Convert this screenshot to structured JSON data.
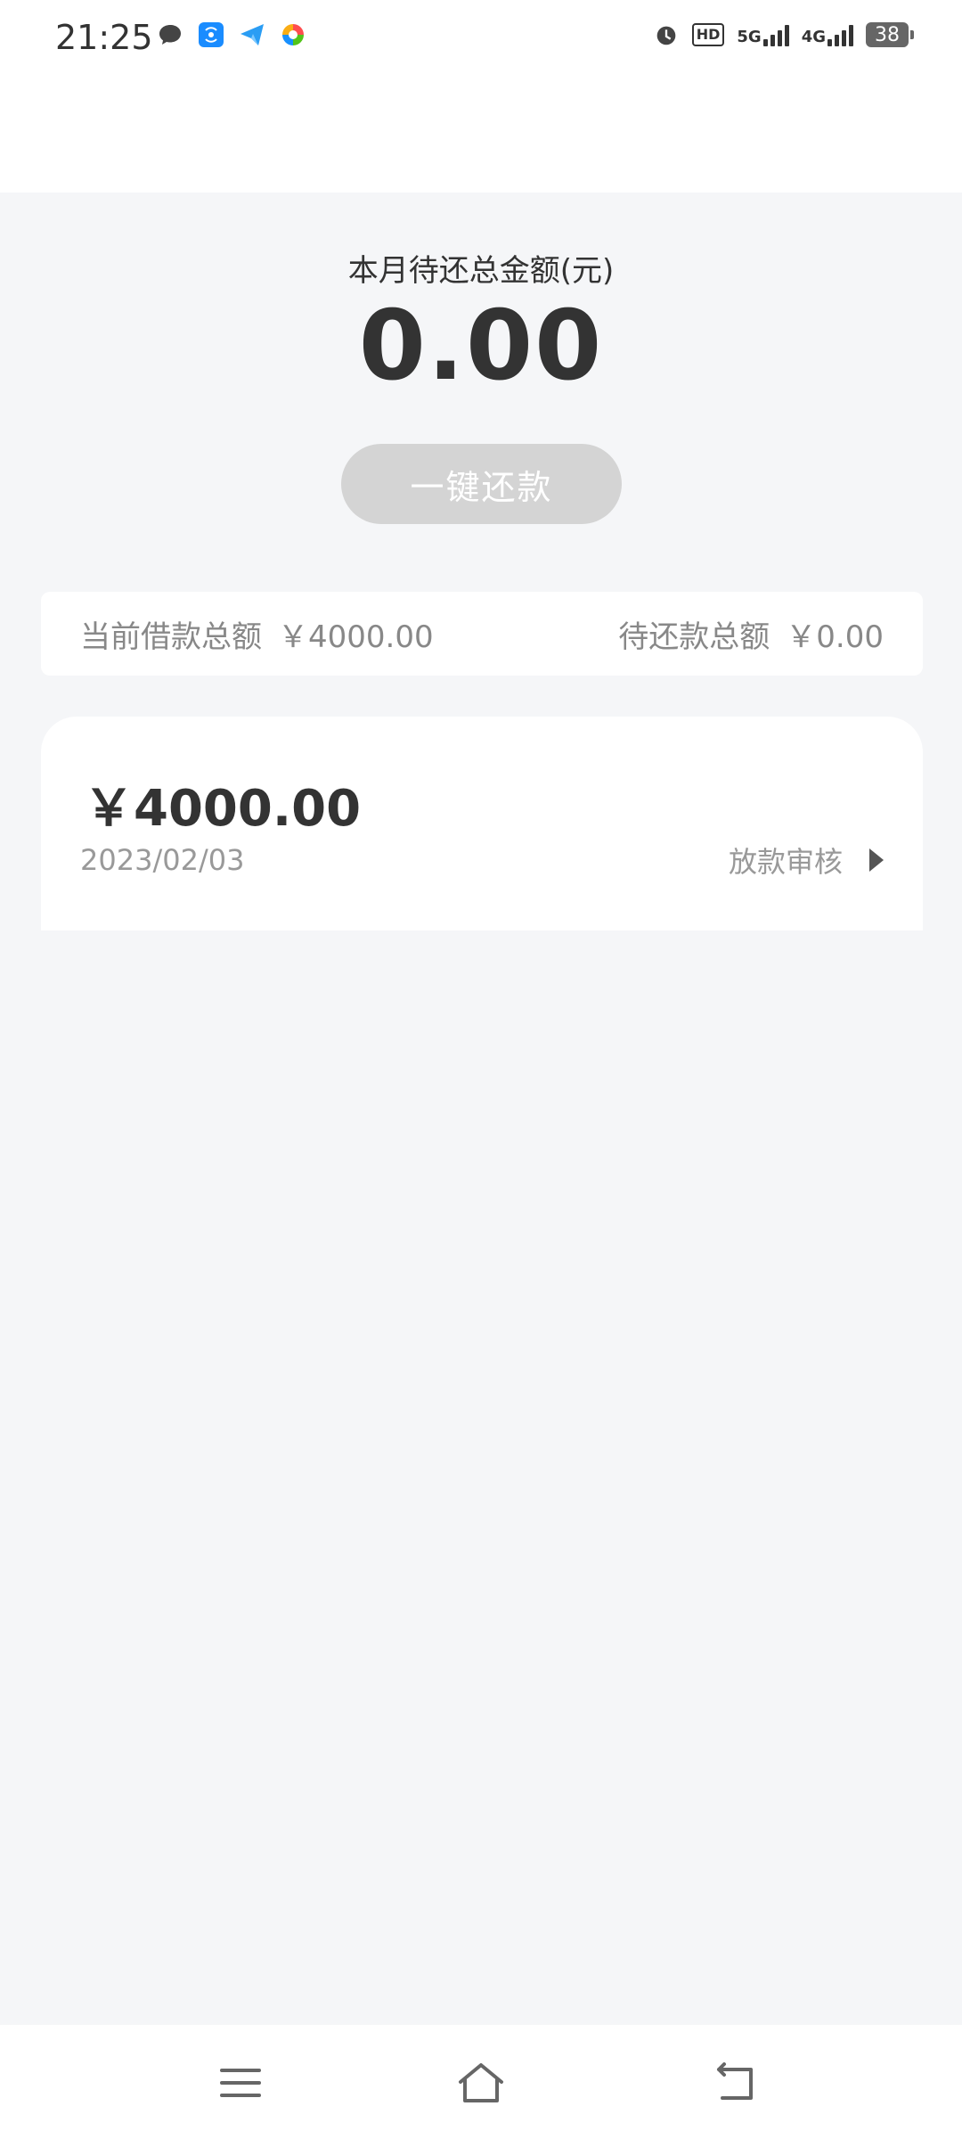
{
  "status_bar": {
    "time": "21:25",
    "left_icons": [
      "chat-bubble-icon",
      "wifi-hotspot-icon",
      "send-app-icon",
      "color-wheel-icon"
    ],
    "right_icons": [
      "alarm-icon",
      "hd-badge-icon",
      "signal-5g-icon",
      "signal-4g-icon",
      "battery-icon"
    ],
    "hd_label": "HD",
    "net_5g": "5G",
    "net_4g": "4G",
    "battery_level": "38"
  },
  "summary": {
    "label": "本月待还总金额(元)",
    "amount": "0.00",
    "repay_button": "一键还款"
  },
  "totals": {
    "current_loan_label": "当前借款总额",
    "current_loan_value": "￥4000.00",
    "pending_repay_label": "待还款总额",
    "pending_repay_value": "￥0.00"
  },
  "loans": [
    {
      "amount": "￥4000.00",
      "date": "2023/02/03",
      "status": "放款审核"
    }
  ],
  "nav_bar": {
    "icons": [
      "menu-icon",
      "home-icon",
      "back-icon"
    ]
  },
  "colors": {
    "background": "#f5f6f8",
    "button_disabled": "#d4d4d4",
    "text_primary": "#333333",
    "text_secondary": "#999999"
  }
}
